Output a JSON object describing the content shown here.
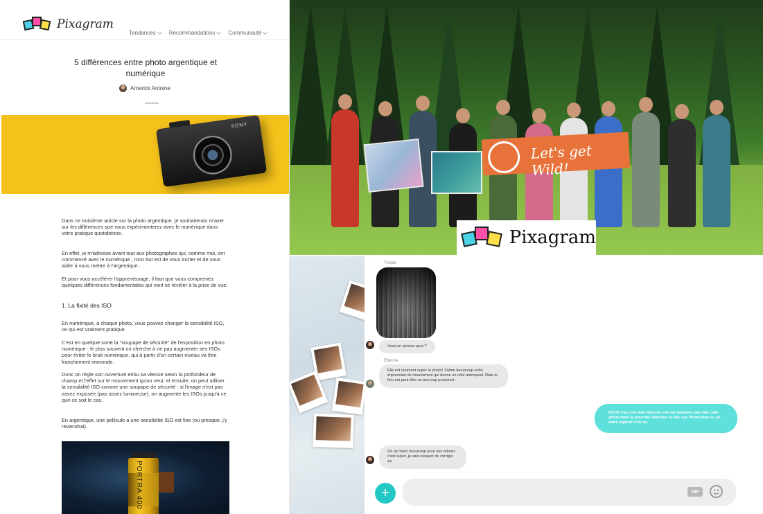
{
  "article": {
    "brand": "Pixagram",
    "nav": [
      "Tendances",
      "Recommandations",
      "Communauté"
    ],
    "title": "5 différences entre photo argentique et numérique",
    "author": "Americk Antoine",
    "date": "12/01/2021",
    "camera_brand": "SONY",
    "paragraphs": [
      "Dans ce troisième article sur la photo argentique, je souhaiterais m'axer sur les différences que vous expérimenterez avec le numérique dans votre pratique quotidienne.",
      "En effet, je m'adresse avant tout aux photographes qui, comme moi, ont commencé avec le numérique ; mon but est de vous inciter et de vous aider à vous mettre à l'argentique.",
      "Et pour vous accélérer l'apprentissage, il faut que vous compreniez quelques différences fondamentales qui vont se révéler à la prise de vue."
    ],
    "section_heading": "1. La fixité des ISO",
    "section_paragraphs": [
      "En numérique, à chaque photo, vous pouvez changer la sensibilité ISO, ce qui est vraiment pratique.",
      "C'est en quelque sorte la  \"soupape de sécurité\" de l'exposition en photo numérique : le plus souvent on cherche à ne pas augmenter ses ISOs pour éviter le bruit numérique, qui à partir d'un certain niveau va être franchement immonde.",
      "Donc on règle son ouverture et/ou sa vitesse selon la profondeur de champ et l'effet sur le mouvement qu'on veut, et ensuite, on peut utiliser la sensibilité ISO comme une soupape de sécurité : si l'image n'est pas assez exposée (pas assez lumineuse), on augmente les ISOs jusqu'à ce que ce soit le cas.",
      "En argentique, une pellicule a une sensibilité ISO est fixe (ou presque, j'y reviendrai)."
    ],
    "film_label": "PORTRA 400"
  },
  "photo": {
    "banner_text": "Let's get Wild!",
    "overlay_brand": "Pixagram"
  },
  "chat": {
    "messages": [
      {
        "sender": "Tristan",
        "text": "Vous en pensez quoi ?"
      },
      {
        "sender": "Etienne",
        "text": "Elle est vraiment super ta photo! J'aime beaucoup cette impression de mouvement qui donne un côté atemporel. Mais le flou est peut-être un peu trop prononcé."
      },
      {
        "sender": "",
        "text": "Plutôt d'accord avec Etienne elle est vraiment pas mal cette photo mais tu pourrais diminuer le flou sur Photoshop ou un autre logiciel si tu as."
      },
      {
        "sender": "",
        "text": "Ok ok merci beaucoup pour vos retours c'est super, je vais essayer de corriger ça."
      }
    ],
    "gif_label": "GIF",
    "plus_label": "+"
  },
  "colors": {
    "accent": "#22c8c3",
    "own_bubble": "#5ee0dc",
    "banner": "#e8733a",
    "camera_bg": "#f4c21b"
  },
  "icons": {
    "plus": "plus-icon",
    "emoji": "emoji-icon",
    "gif": "gif-icon",
    "chevron": "chevron-down-icon"
  }
}
